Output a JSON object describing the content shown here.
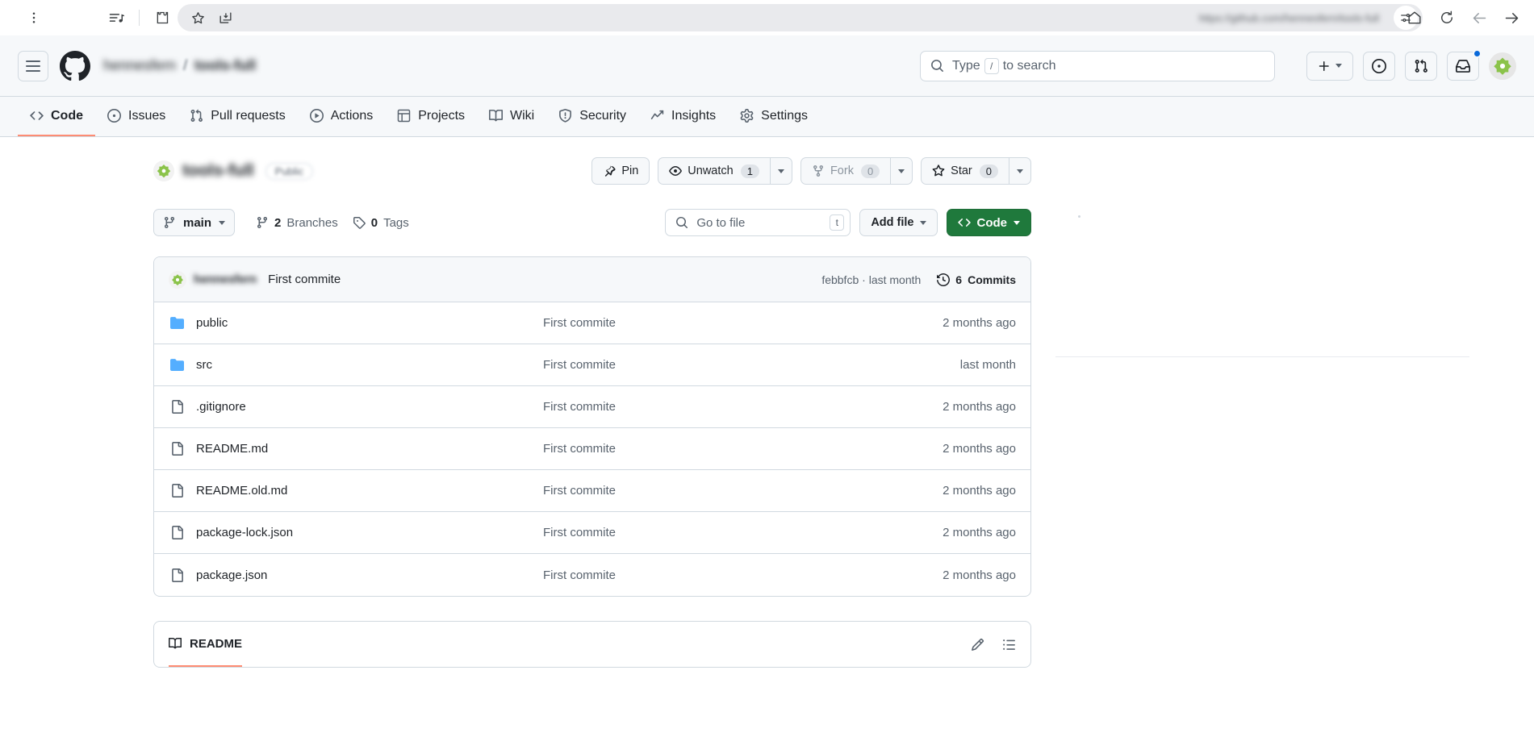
{
  "browser": {
    "menu_icon": "vertical-dots-icon",
    "tab_list_icon": "tab-list-icon",
    "extensions_icon": "extensions-puzzle-icon",
    "bookmark_icon": "bookmark-star-icon",
    "install_icon": "install-app-icon",
    "url": "https://github.com/hennesfern/tools-full",
    "site_settings_icon": "site-settings-icon",
    "home_icon": "home-icon",
    "reload_icon": "reload-icon",
    "back_icon": "back-arrow-icon",
    "forward_icon": "forward-arrow-icon"
  },
  "header": {
    "hamburger_label": "menu",
    "logo": "github-mark-icon",
    "owner": "hennesfern",
    "separator": "/",
    "repo": "tools-full",
    "search": {
      "placeholder_prefix": "Type",
      "placeholder_key": "/",
      "placeholder_suffix": "to search",
      "icon": "search-icon"
    },
    "create_new_icon": "plus-icon",
    "issues_icon": "issue-opened-icon",
    "pull_requests_icon": "git-pull-request-icon",
    "inbox_icon": "inbox-icon",
    "has_notification": true,
    "avatar_icon": "user-avatar"
  },
  "repo_nav": {
    "tabs": [
      {
        "label": "Code",
        "icon": "code-icon",
        "active": true
      },
      {
        "label": "Issues",
        "icon": "issue-opened-icon",
        "active": false
      },
      {
        "label": "Pull requests",
        "icon": "git-pull-request-icon",
        "active": false
      },
      {
        "label": "Actions",
        "icon": "play-icon",
        "active": false
      },
      {
        "label": "Projects",
        "icon": "table-icon",
        "active": false
      },
      {
        "label": "Wiki",
        "icon": "book-icon",
        "active": false
      },
      {
        "label": "Security",
        "icon": "shield-icon",
        "active": false
      },
      {
        "label": "Insights",
        "icon": "graph-icon",
        "active": false
      },
      {
        "label": "Settings",
        "icon": "gear-icon",
        "active": false
      }
    ]
  },
  "repo": {
    "name": "tools-full",
    "visibility": "Public",
    "actions": {
      "pin": "Pin",
      "watch": "Unwatch",
      "watch_count": "1",
      "fork": "Fork",
      "fork_count": "0",
      "star": "Star",
      "star_count": "0"
    }
  },
  "toolbar": {
    "branch": "main",
    "branches_count": "2",
    "branches_label": "Branches",
    "tags_count": "0",
    "tags_label": "Tags",
    "go_to_file_placeholder": "Go to file",
    "go_to_file_kbd": "t",
    "add_file": "Add file",
    "code_button": "Code"
  },
  "latest_commit": {
    "author": "hennesfern",
    "message": "First commite",
    "sha": "febbfcb",
    "sha_separator": "·",
    "relative_time": "last month",
    "commits_count": "6",
    "commits_label": "Commits"
  },
  "files": [
    {
      "name": "public",
      "type": "folder",
      "commit": "First commite",
      "time": "2 months ago"
    },
    {
      "name": "src",
      "type": "folder",
      "commit": "First commite",
      "time": "last month"
    },
    {
      "name": ".gitignore",
      "type": "file",
      "commit": "First commite",
      "time": "2 months ago"
    },
    {
      "name": "README.md",
      "type": "file",
      "commit": "First commite",
      "time": "2 months ago"
    },
    {
      "name": "README.old.md",
      "type": "file",
      "commit": "First commite",
      "time": "2 months ago"
    },
    {
      "name": "package-lock.json",
      "type": "file",
      "commit": "First commite",
      "time": "2 months ago"
    },
    {
      "name": "package.json",
      "type": "file",
      "commit": "First commite",
      "time": "2 months ago"
    }
  ],
  "readme": {
    "tab_label": "README",
    "book_icon": "book-icon",
    "edit_icon": "pencil-edit-icon",
    "outline_icon": "outline-list-icon"
  },
  "colors": {
    "accent_green": "#1f793c",
    "underline_orange": "#fd8c73",
    "folder_blue": "#54aeff",
    "notification_blue": "#0969da",
    "border": "#d1d9e0",
    "canvas_subtle": "#f6f8fa",
    "text_muted": "#59636e"
  }
}
